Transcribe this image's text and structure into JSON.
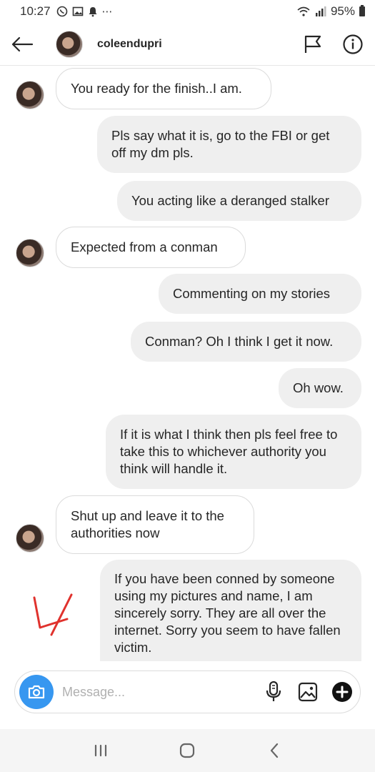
{
  "status_bar": {
    "time": "10:27",
    "dots": "⋯",
    "battery": "95%"
  },
  "header": {
    "username": "coleendupri"
  },
  "messages": [
    {
      "direction": "in",
      "text": "You ready for the finish..I am."
    },
    {
      "direction": "out",
      "text": "Pls say what it is, go to the FBI or get off my dm pls."
    },
    {
      "direction": "out",
      "text": "You acting like a deranged stalker"
    },
    {
      "direction": "in",
      "text": "Expected from a conman"
    },
    {
      "direction": "out",
      "text": "Commenting on my stories"
    },
    {
      "direction": "out",
      "text": "Conman? Oh I think I get it now."
    },
    {
      "direction": "out",
      "text": "Oh wow."
    },
    {
      "direction": "out",
      "text": "If it is what I think then pls feel free to take this to whichever authority you think will handle it."
    },
    {
      "direction": "in",
      "text": "Shut up and leave it to the authorities now"
    },
    {
      "direction": "out",
      "text": "If you have been conned by someone using my pictures and name, I am sincerely sorry. They are all over the internet. Sorry you seem to have fallen victim."
    }
  ],
  "composer": {
    "placeholder": "Message..."
  },
  "colors": {
    "accent": "#3797f0",
    "outgoing_bubble": "#efefef",
    "annotation": "#e0322d"
  }
}
